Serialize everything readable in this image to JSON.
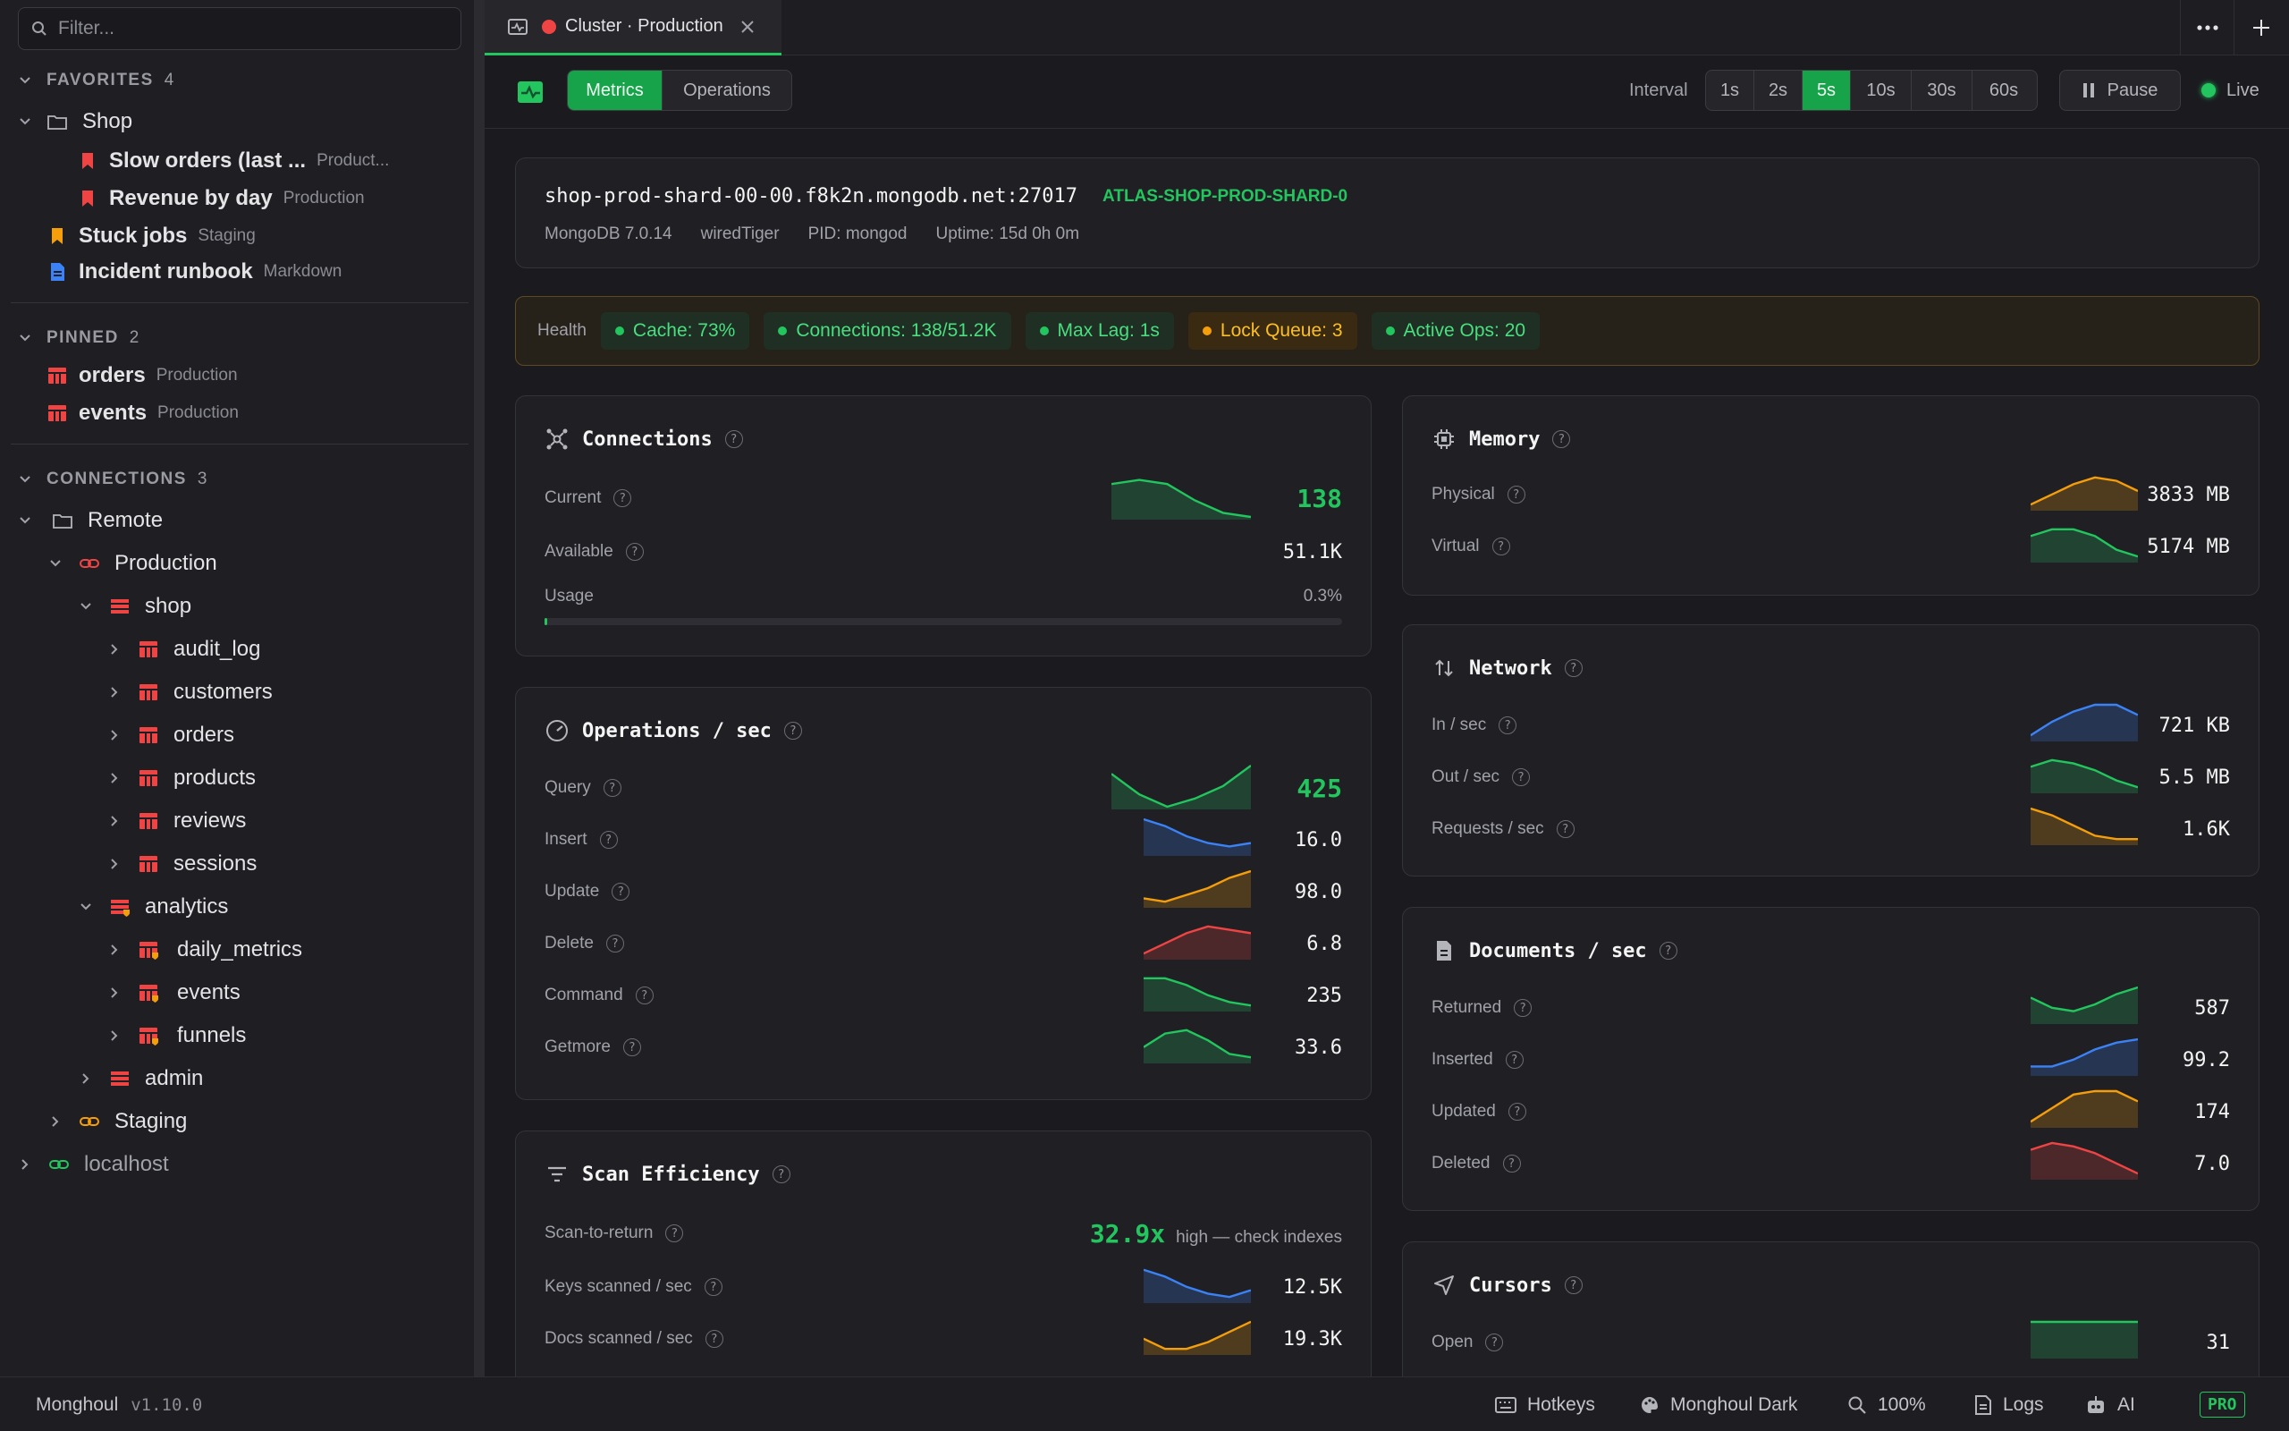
{
  "sidebar": {
    "filter_placeholder": "Filter...",
    "favorites": {
      "label": "FAVORITES",
      "count": "4",
      "folder": "Shop",
      "items": [
        {
          "name": "Slow orders (last ...",
          "sub": "Product..."
        },
        {
          "name": "Revenue by day",
          "sub": "Production"
        },
        {
          "name": "Stuck jobs",
          "sub": "Staging"
        },
        {
          "name": "Incident runbook",
          "sub": "Markdown"
        }
      ]
    },
    "pinned": {
      "label": "PINNED",
      "count": "2",
      "items": [
        {
          "name": "orders",
          "sub": "Production"
        },
        {
          "name": "events",
          "sub": "Production"
        }
      ]
    },
    "connections": {
      "label": "CONNECTIONS",
      "count": "3",
      "remote": "Remote",
      "production": "Production",
      "shop": "shop",
      "shop_collections": [
        "audit_log",
        "customers",
        "orders",
        "products",
        "reviews",
        "sessions"
      ],
      "analytics": "analytics",
      "analytics_collections": [
        "daily_metrics",
        "events",
        "funnels"
      ],
      "admin": "admin",
      "staging": "Staging",
      "localhost": "localhost"
    }
  },
  "tab": {
    "title": "Cluster · Production"
  },
  "toolbar": {
    "metrics": "Metrics",
    "operations": "Operations",
    "interval_label": "Interval",
    "intervals": [
      "1s",
      "2s",
      "5s",
      "10s",
      "30s",
      "60s"
    ],
    "interval_selected": "5s",
    "pause": "Pause",
    "live": "Live"
  },
  "server": {
    "host": "shop-prod-shard-00-00.f8k2n.mongodb.net:27017",
    "tag": "ATLAS-SHOP-PROD-SHARD-0",
    "version": "MongoDB 7.0.14",
    "engine": "wiredTiger",
    "pid": "PID: mongod",
    "uptime": "Uptime: 15d 0h 0m"
  },
  "health": {
    "label": "Health",
    "pills": [
      "Cache: 73%",
      "Connections: 138/51.2K",
      "Max Lag: 1s",
      "Lock Queue: 3",
      "Active Ops: 20"
    ]
  },
  "connections_card": {
    "title": "Connections",
    "current_label": "Current",
    "current": "138",
    "available_label": "Available",
    "available": "51.1K",
    "usage_label": "Usage",
    "usage": "0.3%",
    "usage_fraction": 0.003
  },
  "ops_card": {
    "title": "Operations / sec",
    "rows": [
      {
        "label": "Query",
        "value": "425"
      },
      {
        "label": "Insert",
        "value": "16.0"
      },
      {
        "label": "Update",
        "value": "98.0"
      },
      {
        "label": "Delete",
        "value": "6.8"
      },
      {
        "label": "Command",
        "value": "235"
      },
      {
        "label": "Getmore",
        "value": "33.6"
      }
    ]
  },
  "scan_card": {
    "title": "Scan Efficiency",
    "ratio_label": "Scan-to-return",
    "ratio": "32.9x",
    "ratio_note": "high — check indexes",
    "keys_label": "Keys scanned / sec",
    "keys": "12.5K",
    "docs_label": "Docs scanned / sec",
    "docs": "19.3K"
  },
  "memory_card": {
    "title": "Memory",
    "physical_label": "Physical",
    "physical": "3833 MB",
    "virtual_label": "Virtual",
    "virtual": "5174 MB"
  },
  "network_card": {
    "title": "Network",
    "in_label": "In / sec",
    "in": "721 KB",
    "out_label": "Out / sec",
    "out": "5.5 MB",
    "req_label": "Requests / sec",
    "req": "1.6K"
  },
  "docs_card": {
    "title": "Documents / sec",
    "rows": [
      {
        "label": "Returned",
        "value": "587"
      },
      {
        "label": "Inserted",
        "value": "99.2"
      },
      {
        "label": "Updated",
        "value": "174"
      },
      {
        "label": "Deleted",
        "value": "7.0"
      }
    ]
  },
  "cursors_card": {
    "title": "Cursors",
    "open_label": "Open",
    "open": "31"
  },
  "statusbar": {
    "app": "Monghoul",
    "version": "v1.10.0",
    "hotkeys": "Hotkeys",
    "theme": "Monghoul Dark",
    "zoom": "100%",
    "logs": "Logs",
    "ai": "AI",
    "pro": "PRO"
  },
  "colors": {
    "accent": "#22c55e",
    "blue": "#3b82f6",
    "orange": "#f59e0b",
    "red": "#ef4444"
  }
}
